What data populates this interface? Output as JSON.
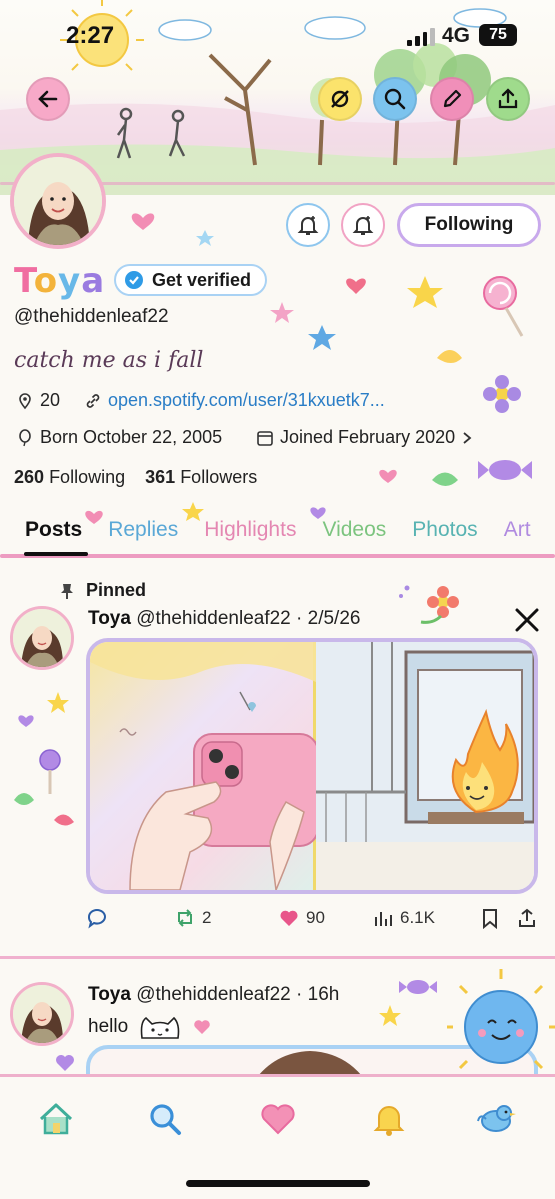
{
  "status_bar": {
    "time": "2:27",
    "network": "4G",
    "battery": "75"
  },
  "header": {
    "icons": [
      "back-arrow-icon",
      "mute-icon",
      "search-icon",
      "pencil-icon",
      "share-icon"
    ]
  },
  "profile": {
    "buttons": {
      "following_label": "Following"
    },
    "name": [
      "T",
      "o",
      "y",
      "a"
    ],
    "verified_label": "Get verified",
    "handle": "@thehiddenleaf22",
    "bio": "catch me as i fall",
    "location": "20",
    "link": "open.spotify.com/user/31kxuetk7...",
    "born": "Born October 22, 2005",
    "joined": "Joined February 2020",
    "following_count": "260",
    "following_label": "Following",
    "followers_count": "361",
    "followers_label": "Followers"
  },
  "tabs": [
    "Posts",
    "Replies",
    "Highlights",
    "Videos",
    "Photos",
    "Art"
  ],
  "tab_colors": [
    "#111111",
    "#5aa8d6",
    "#e487b2",
    "#7cc47f",
    "#58b3b2",
    "#b08be0"
  ],
  "posts": [
    {
      "pinned_label": "Pinned",
      "name": "Toya",
      "handle": "@thehiddenleaf22",
      "date": "2/5/26",
      "reposts": "2",
      "likes": "90",
      "views": "6.1K"
    },
    {
      "name": "Toya",
      "handle": "@thehiddenleaf22",
      "date": "16h",
      "text": "hello"
    }
  ],
  "bottom_nav": [
    "home-icon",
    "search-icon",
    "heart-icon",
    "bell-icon",
    "bird-icon"
  ],
  "colors": {
    "accent_pink": "#ee9fc4",
    "link_blue": "#2a7dc6",
    "like_pink": "#e8568a",
    "repost_green": "#3fa36a"
  }
}
